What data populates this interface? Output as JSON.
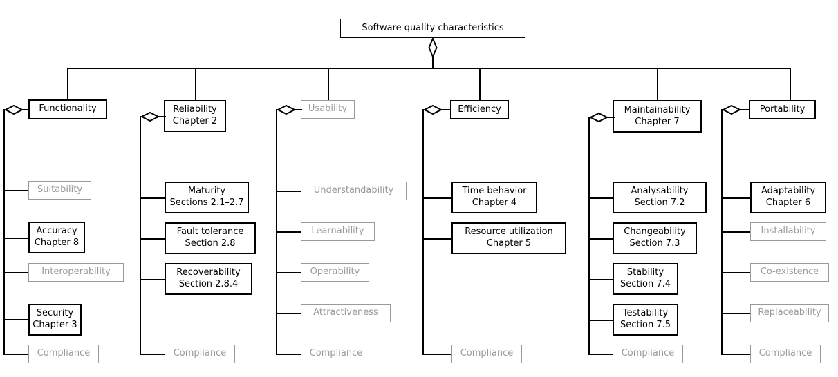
{
  "diagram": {
    "title": "Software quality characteristics",
    "type": "uml-aggregation-tree",
    "root": {
      "label": "Software quality characteristics",
      "style": "solid"
    },
    "columns": [
      {
        "id": "functionality",
        "parent": {
          "line1": "Functionality",
          "line2": "",
          "style": "solid"
        },
        "children": [
          {
            "line1": "Suitability",
            "line2": "",
            "style": "faded"
          },
          {
            "line1": "Accuracy",
            "line2": "Chapter 8",
            "style": "solid"
          },
          {
            "line1": "Interoperability",
            "line2": "",
            "style": "faded"
          },
          {
            "line1": "Security",
            "line2": "Chapter 3",
            "style": "solid"
          },
          {
            "line1": "Compliance",
            "line2": "",
            "style": "faded"
          }
        ]
      },
      {
        "id": "reliability",
        "parent": {
          "line1": "Reliability",
          "line2": "Chapter 2",
          "style": "solid"
        },
        "children": [
          {
            "line1": "Maturity",
            "line2": "Sections 2.1–2.7",
            "style": "solid"
          },
          {
            "line1": "Fault tolerance",
            "line2": "Section 2.8",
            "style": "solid"
          },
          {
            "line1": "Recoverability",
            "line2": "Section 2.8.4",
            "style": "solid"
          },
          {
            "line1": "Compliance",
            "line2": "",
            "style": "faded"
          }
        ]
      },
      {
        "id": "usability",
        "parent": {
          "line1": "Usability",
          "line2": "",
          "style": "faded"
        },
        "children": [
          {
            "line1": "Understandability",
            "line2": "",
            "style": "faded"
          },
          {
            "line1": "Learnability",
            "line2": "",
            "style": "faded"
          },
          {
            "line1": "Operability",
            "line2": "",
            "style": "faded"
          },
          {
            "line1": "Attractiveness",
            "line2": "",
            "style": "faded"
          },
          {
            "line1": "Compliance",
            "line2": "",
            "style": "faded"
          }
        ]
      },
      {
        "id": "efficiency",
        "parent": {
          "line1": "Efficiency",
          "line2": "",
          "style": "solid"
        },
        "children": [
          {
            "line1": "Time behavior",
            "line2": "Chapter 4",
            "style": "solid"
          },
          {
            "line1": "Resource utilization",
            "line2": "Chapter 5",
            "style": "solid"
          },
          {
            "line1": "Compliance",
            "line2": "",
            "style": "faded"
          }
        ]
      },
      {
        "id": "maintainability",
        "parent": {
          "line1": "Maintainability",
          "line2": "Chapter 7",
          "style": "solid"
        },
        "children": [
          {
            "line1": "Analysability",
            "line2": "Section 7.2",
            "style": "solid"
          },
          {
            "line1": "Changeability",
            "line2": "Section 7.3",
            "style": "solid"
          },
          {
            "line1": "Stability",
            "line2": "Section 7.4",
            "style": "solid"
          },
          {
            "line1": "Testability",
            "line2": "Section 7.5",
            "style": "solid"
          },
          {
            "line1": "Compliance",
            "line2": "",
            "style": "faded"
          }
        ]
      },
      {
        "id": "portability",
        "parent": {
          "line1": "Portability",
          "line2": "",
          "style": "solid"
        },
        "children": [
          {
            "line1": "Adaptability",
            "line2": "Chapter 6",
            "style": "solid"
          },
          {
            "line1": "Installability",
            "line2": "",
            "style": "faded"
          },
          {
            "line1": "Co-existence",
            "line2": "",
            "style": "faded"
          },
          {
            "line1": "Replaceability",
            "line2": "",
            "style": "faded"
          },
          {
            "line1": "Compliance",
            "line2": "",
            "style": "faded"
          }
        ]
      }
    ],
    "colors": {
      "line": "#000000",
      "solid_border": "#000000",
      "solid_text": "#000000",
      "faded_border": "#9a9a9a",
      "faded_text": "#9a9a9a",
      "background": "#ffffff"
    }
  }
}
